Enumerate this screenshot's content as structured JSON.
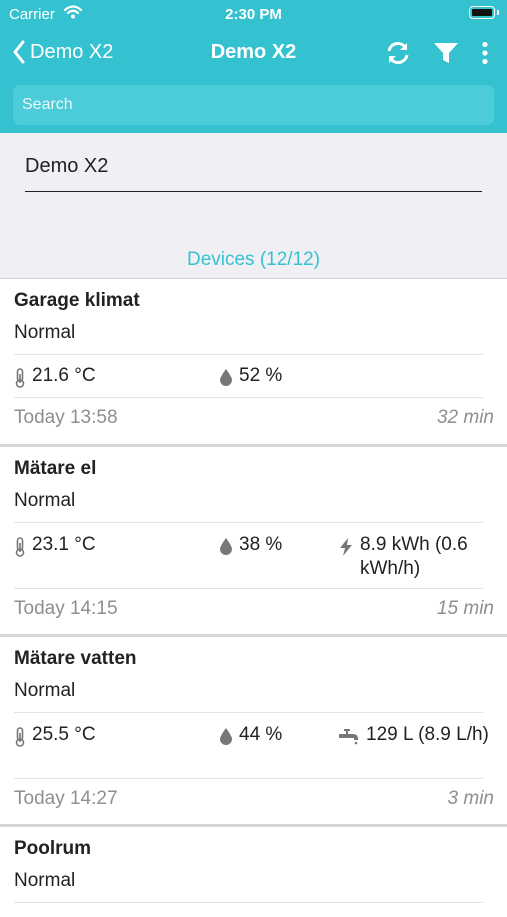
{
  "status_bar": {
    "carrier": "Carrier",
    "time": "2:30 PM"
  },
  "nav": {
    "back_label": "Demo X2",
    "title": "Demo X2"
  },
  "search": {
    "placeholder": "Search"
  },
  "account": {
    "name": "Demo X2"
  },
  "devices_header": "Devices (12/12)",
  "colors": {
    "accent": "#35c2d0",
    "search_bg": "#4ccbd8",
    "section_bg": "#efeff4",
    "muted_text": "#8e8e93"
  },
  "devices": [
    {
      "name": "Garage klimat",
      "status": "Normal",
      "temperature": "21.6 °C",
      "humidity": "52 %",
      "time": "Today 13:58",
      "ago": "32 min"
    },
    {
      "name": "Mätare el",
      "status": "Normal",
      "temperature": "23.1 °C",
      "humidity": "38 %",
      "energy_line1": "8.9 kWh (0.6",
      "energy_line2": "kWh/h)",
      "time": "Today 14:15",
      "ago": "15 min"
    },
    {
      "name": "Mätare vatten",
      "status": "Normal",
      "temperature": "25.5 °C",
      "humidity": "44 %",
      "water": "129 L (8.9 L/h)",
      "time": "Today 14:27",
      "ago": "3 min"
    },
    {
      "name": "Poolrum",
      "status": "Normal"
    }
  ]
}
